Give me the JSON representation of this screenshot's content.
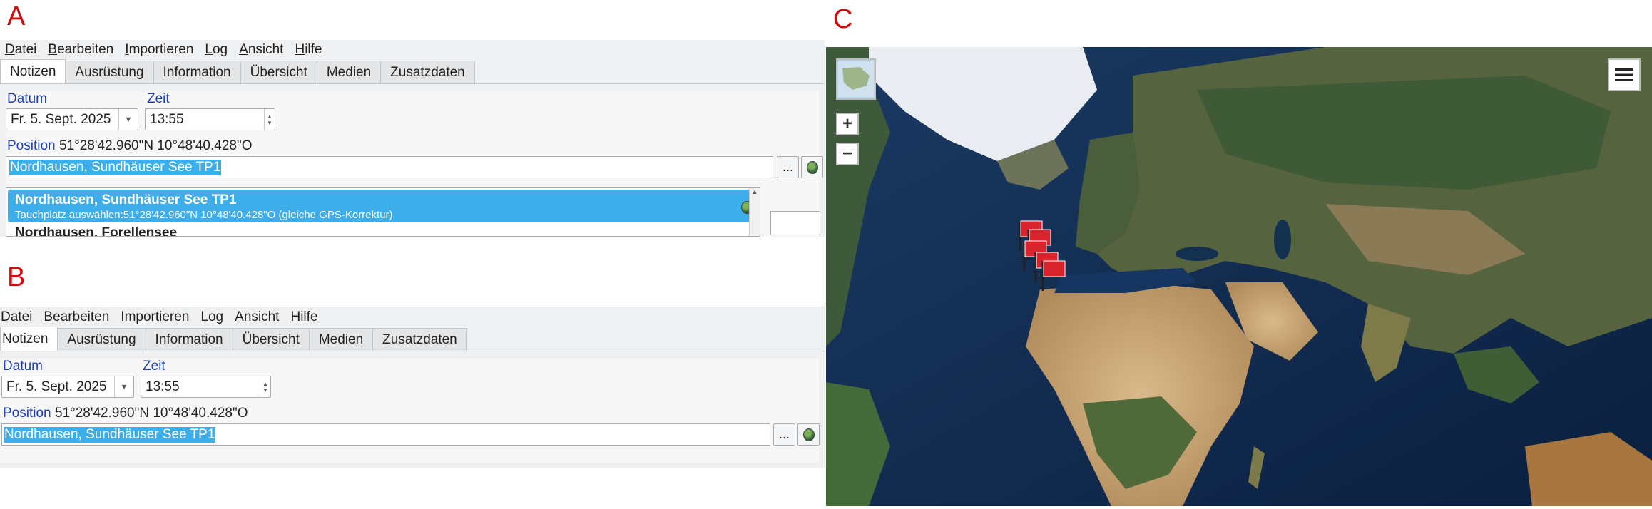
{
  "labels": {
    "a": "A",
    "b": "B",
    "c": "C"
  },
  "menu": [
    "Datei",
    "Bearbeiten",
    "Importieren",
    "Log",
    "Ansicht",
    "Hilfe"
  ],
  "tabs": [
    "Notizen",
    "Ausrüstung",
    "Information",
    "Übersicht",
    "Medien",
    "Zusatzdaten"
  ],
  "form": {
    "date_label": "Datum",
    "time_label": "Zeit",
    "date_value": "Fr. 5. Sept. 2025",
    "time_value": "13:55",
    "position_label": "Position",
    "position_coords": "51°28'42.960\"N 10°48'40.428\"O",
    "location_value": "Nordhausen, Sundhäuser See TP1",
    "dots_button": "..."
  },
  "dropdown": {
    "selected_title": "Nordhausen, Sundhäuser See TP1",
    "selected_subtitle": "Tauchplatz auswählen:51°28'42.960\"N 10°48'40.428\"O (gleiche GPS-Korrektur)",
    "next_item": "Nordhausen, Forellensee"
  },
  "map": {
    "zoom_in": "+",
    "zoom_out": "−",
    "menu_icon": "hamburger-menu-icon",
    "marker_color": "#d9232d",
    "selection_color": "#3daee9"
  }
}
